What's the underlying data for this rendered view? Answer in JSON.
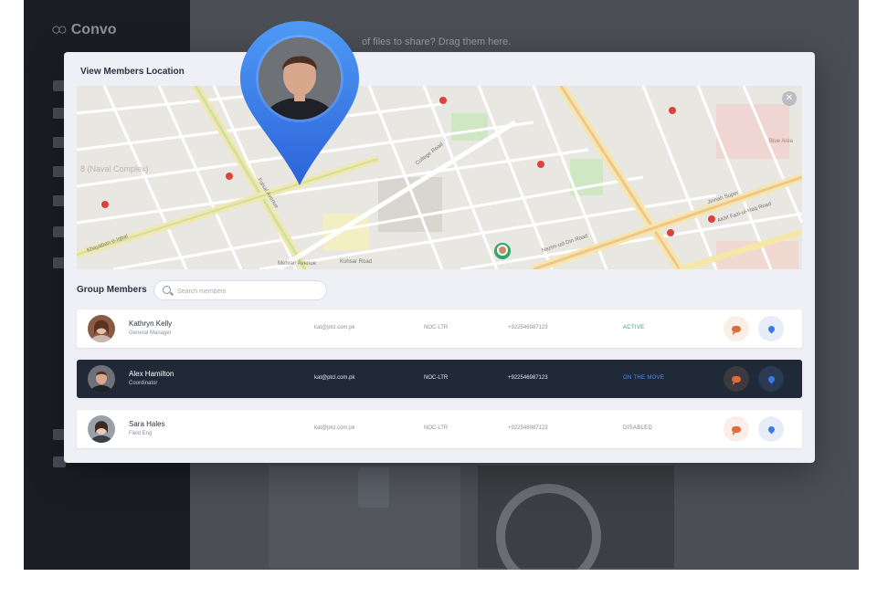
{
  "app": {
    "name": "Convo"
  },
  "background": {
    "drop_hint": "of files to share? Drag them here."
  },
  "modal": {
    "title": "View Members Location"
  },
  "group": {
    "label": "Group Members",
    "search_placeholder": "Search members"
  },
  "map_labels": {
    "naval": "8 (Naval Complex)",
    "college_road": "College Road",
    "nazim": "Nazim-ud-Din Road",
    "jinnah": "Jinnah Super",
    "faisal": "Faisal Avenue",
    "khayaban": "Khayaban-e-Iqbal",
    "kohsar": "Kohsar Road",
    "mehran": "Mehran Avenue",
    "blue_area": "Blue Area",
    "fazal_haq": "AKM Fazl-ul-Haq Road"
  },
  "members": [
    {
      "name": "Kathryn Kelly",
      "role": "General Manager",
      "email": "kat@ptcl.com.pk",
      "dept": "NOC-LTR",
      "phone": "+922546987123",
      "status": "ACTIVE",
      "status_color": "#2fa865",
      "selected": false
    },
    {
      "name": "Alex Hamilton",
      "role": "Coordinator",
      "email": "kat@ptcl.com.pk",
      "dept": "NOC-LTR",
      "phone": "+922546987123",
      "status": "ON THE MOVE",
      "status_color": "#4f8ef7",
      "selected": true
    },
    {
      "name": "Sara Hales",
      "role": "Field Eng",
      "email": "kat@ptcl.com.pk",
      "dept": "NOC-LTR",
      "phone": "+922546987123",
      "status": "DISABLED",
      "status_color": "#7c8089",
      "selected": false
    }
  ],
  "colors": {
    "sidebar": "#1a1d24",
    "pin": "#3b7be6",
    "selected_row": "#1f2937"
  }
}
